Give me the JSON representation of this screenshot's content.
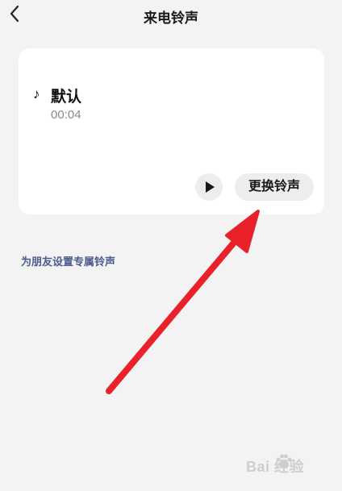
{
  "header": {
    "title": "来电铃声",
    "back_icon": "chevron-left-icon"
  },
  "ringtone": {
    "note_icon": "music-note-icon",
    "note_glyph": "♪",
    "name": "默认",
    "duration": "00:04"
  },
  "actions": {
    "play_icon": "play-icon",
    "change_label": "更换铃声"
  },
  "friends_link": "为朋友设置专属铃声",
  "annotation": {
    "arrow_color": "#e8212b"
  },
  "watermark": {
    "brand_text": "Bai 经验",
    "brand_icon": "paw-icon"
  },
  "colors": {
    "background": "#f3f3f3",
    "card": "#ffffff",
    "link": "#4a5d8c",
    "pill": "#ededed"
  }
}
